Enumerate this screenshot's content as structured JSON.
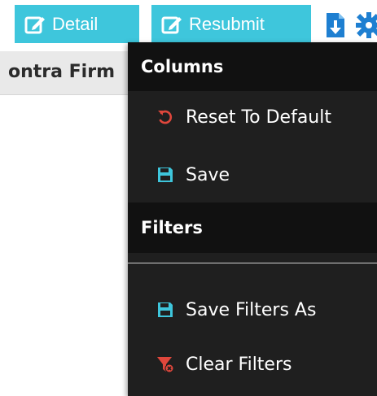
{
  "toolbar": {
    "detail_label": "Detail",
    "resubmit_label": "Resubmit",
    "accent_color": "#3ec6dc"
  },
  "grid": {
    "column_header": "ontra Firm"
  },
  "menu": {
    "columns_heading": "Columns",
    "reset_label": "Reset To Default",
    "save_label": "Save",
    "filters_heading": "Filters",
    "save_filters_label": "Save Filters As",
    "clear_filters_label": "Clear Filters"
  },
  "icons": {
    "detail": "edit-icon",
    "resubmit": "edit-icon",
    "download": "file-download-icon",
    "settings": "gear-icon",
    "reset": "undo-icon",
    "save": "floppy-disk-icon",
    "clear_filters": "filter-remove-icon"
  },
  "colors": {
    "menu_background": "#1f1f1f",
    "menu_heading_background": "#111111",
    "reset_icon": "#e0473c",
    "save_icon": "#3ec6dc",
    "clear_filter_icon": "#e0473c"
  }
}
